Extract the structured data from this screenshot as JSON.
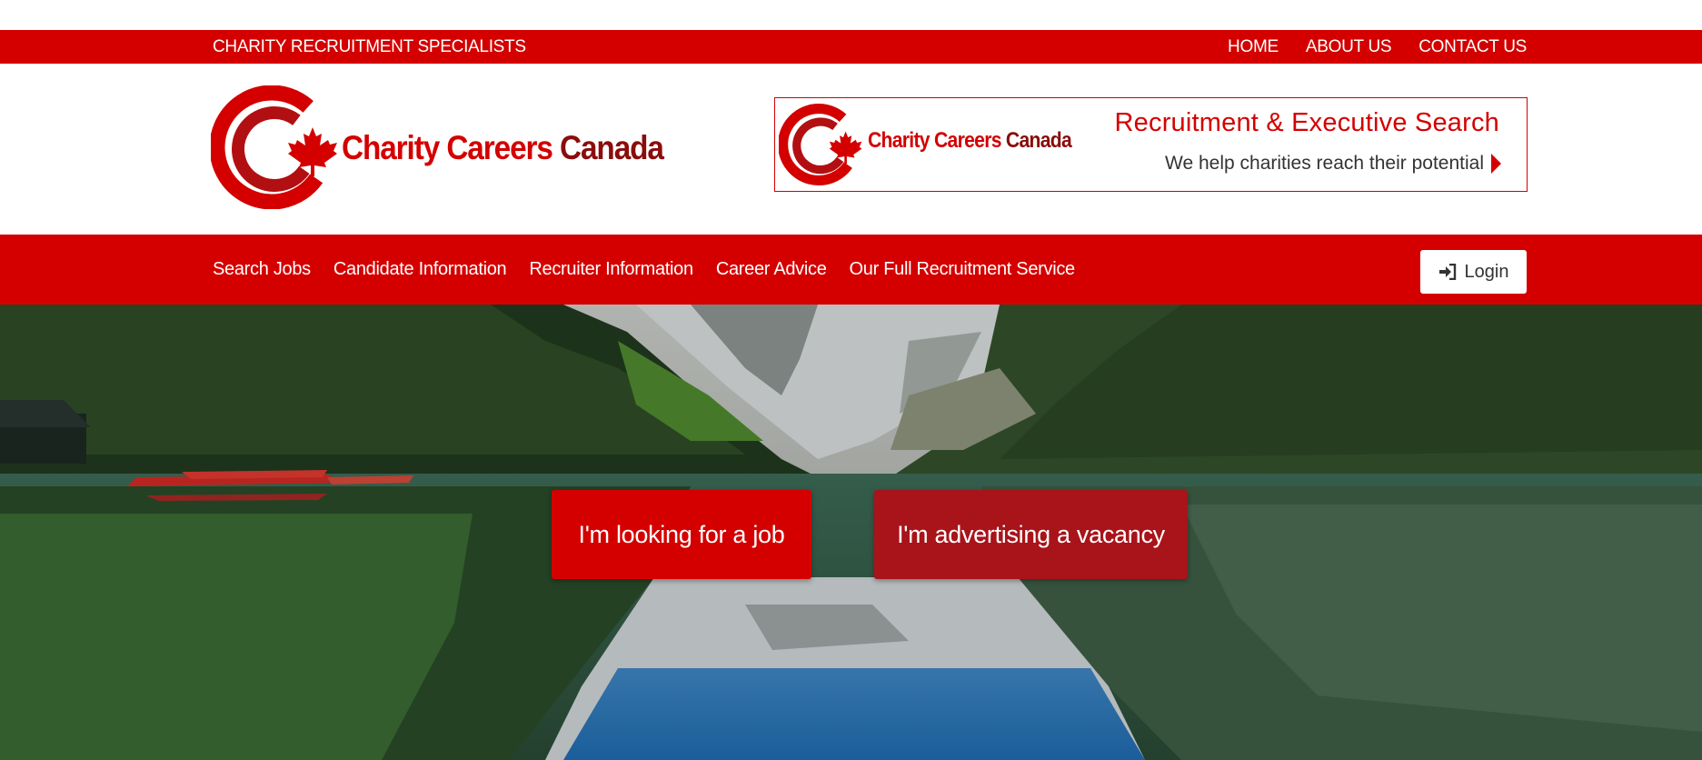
{
  "topbar": {
    "tagline": "CHARITY RECRUITMENT SPECIALISTS",
    "links": [
      "HOME",
      "ABOUT US",
      "CONTACT US"
    ]
  },
  "logo": {
    "text_red": "Charity Careers",
    "text_dark": "Canada"
  },
  "banner": {
    "logo_text_red": "Charity Careers",
    "logo_text_dark": "Canada",
    "headline": "Recruitment & Executive Search",
    "subline": "We help charities reach their potential"
  },
  "nav": {
    "items": [
      "Search Jobs",
      "Candidate Information",
      "Recruiter Information",
      "Career Advice",
      "Our Full Recruitment Service"
    ],
    "login_label": "Login"
  },
  "hero": {
    "job_button": "I'm looking for a job",
    "vacancy_button": "I'm advertising a vacancy"
  },
  "colors": {
    "brand_red": "#d40000",
    "dark_red": "#8b0c0c",
    "vacancy_button": "#a8141a"
  },
  "icons": [
    "maple-leaf-icon",
    "sign-in-icon",
    "caret-right-icon"
  ]
}
